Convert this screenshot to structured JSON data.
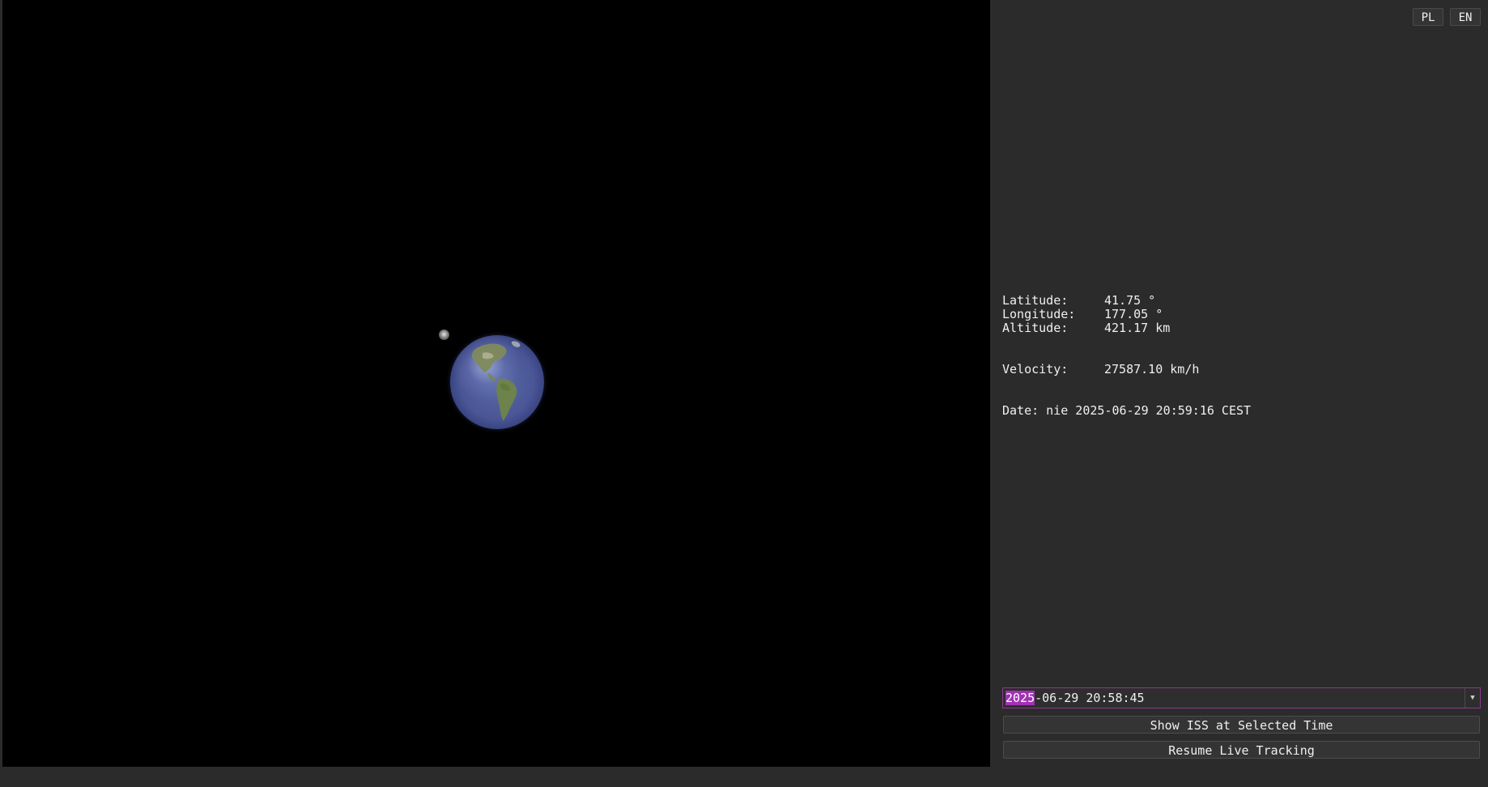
{
  "language_buttons": {
    "pl": "PL",
    "en": "EN"
  },
  "telemetry": {
    "latitude": {
      "label": "Latitude:",
      "value": "41.75 °"
    },
    "longitude": {
      "label": "Longitude:",
      "value": "177.05 °"
    },
    "altitude": {
      "label": "Altitude:",
      "value": "421.17 km"
    },
    "velocity": {
      "label": "Velocity:",
      "value": "27587.10 km/h"
    },
    "date": "Date: nie 2025-06-29 20:59:16 CEST"
  },
  "datetime_picker": {
    "selected_part": "2025",
    "rest": "-06-29 20:58:45"
  },
  "actions": {
    "show_selected": "Show ISS at Selected Time",
    "resume_live": "Resume Live Tracking"
  },
  "icons": {
    "dropdown": "chevron-down-icon"
  },
  "colors": {
    "panel_bg": "#2b2b2b",
    "viewport_bg": "#000000",
    "input_focus_border": "#8a3a8a",
    "selection_bg": "#a032b4",
    "earth_ocean": "#4a5696"
  }
}
